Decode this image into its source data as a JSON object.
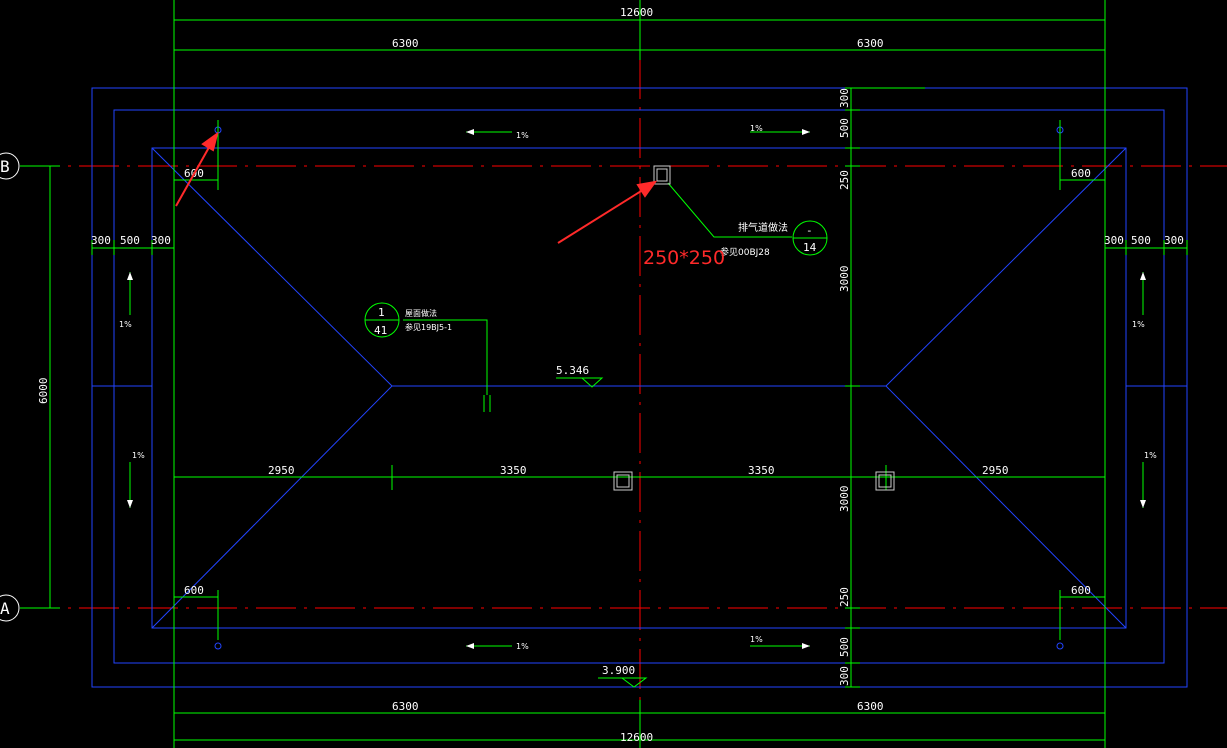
{
  "drawing": {
    "colors": {
      "background": "#000000",
      "dimension_lines": "#00ff00",
      "roof_outline": "#2244ff",
      "axis_lines": "#ff0000",
      "text": "#ffffff",
      "annotation": "#ff2a2a"
    },
    "axes": {
      "b": "B",
      "a": "A"
    },
    "dims": {
      "top_total": "12600",
      "top_left": "6300",
      "top_right": "6300",
      "bottom_left": "6300",
      "bottom_right": "6300",
      "bottom_total": "12600",
      "left_vertical": "6000",
      "right_300_top": "300",
      "right_500_top": "500",
      "right_250_top": "250",
      "right_3000_top": "3000",
      "right_3000_bottom": "3000",
      "right_250_bottom": "250",
      "right_500_bottom": "500",
      "right_300_bottom": "300",
      "left_300a": "300",
      "left_500": "500",
      "left_300b": "300",
      "right_300a": "300",
      "right_500": "500",
      "right_300b": "300",
      "corner_600_tl": "600",
      "corner_600_tr": "600",
      "corner_600_bl": "600",
      "corner_600_br": "600",
      "mid_2950_left": "2950",
      "mid_3350_left": "3350",
      "mid_3350_right": "3350",
      "mid_2950_right": "2950"
    },
    "elevations": {
      "ridge": "5.346",
      "eave": "3.900"
    },
    "slopes": {
      "top_left": "1%",
      "top_right": "1%",
      "bottom_left": "1%",
      "bottom_right": "1%",
      "left_upper": "1%",
      "left_lower": "1%",
      "right_upper": "1%",
      "right_lower": "1%"
    },
    "callout_vent": {
      "title": "排气道做法",
      "ref": "参见00BJ28",
      "top": "-",
      "bottom": "14"
    },
    "callout_detail": {
      "title": "屋面做法",
      "ref": "参见19BJ5-1",
      "top": "1",
      "bottom": "41"
    },
    "annotation": {
      "text": "250*250"
    }
  }
}
